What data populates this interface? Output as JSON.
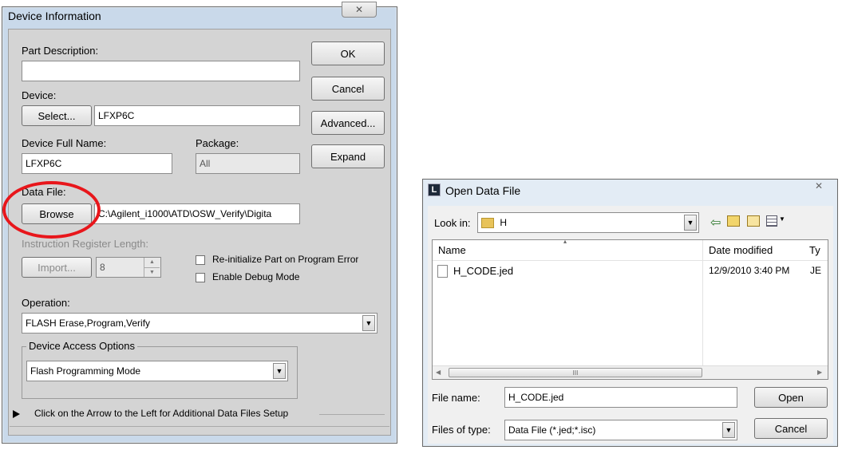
{
  "device_info": {
    "title": "Device Information",
    "close_icon": "✕",
    "part_description_label": "Part Description:",
    "part_description_value": "",
    "ok_label": "OK",
    "cancel_label": "Cancel",
    "advanced_label": "Advanced...",
    "expand_label": "Expand",
    "device_label": "Device:",
    "select_label": "Select...",
    "device_value": "LFXP6C",
    "device_full_name_label": "Device Full Name:",
    "device_full_name_value": "LFXP6C",
    "package_label": "Package:",
    "package_value": "All",
    "data_file_label": "Data File:",
    "browse_label": "Browse",
    "data_file_path": "C:\\Agilent_i1000\\ATD\\OSW_Verify\\Digita",
    "ir_length_label": "Instruction Register Length:",
    "import_label": "Import...",
    "ir_value": "8",
    "reinit_label": "Re-initialize Part on Program Error",
    "debug_label": "Enable Debug Mode",
    "operation_label": "Operation:",
    "operation_value": "FLASH Erase,Program,Verify",
    "access_group_label": "Device Access Options",
    "access_value": "Flash Programming Mode",
    "footer_text": "Click on the Arrow to the Left for Additional Data Files Setup",
    "highlight_color": "#e8161b"
  },
  "open_file": {
    "title": "Open Data File",
    "app_icon": "L",
    "look_in_label": "Look in:",
    "look_in_value": "H",
    "col_name": "Name",
    "col_date": "Date modified",
    "col_type": "Ty",
    "files": [
      {
        "name": "H_CODE.jed",
        "date": "12/9/2010 3:40 PM",
        "type": "JE"
      }
    ],
    "scroll_mid": "III",
    "file_name_label": "File name:",
    "file_name_value": "H_CODE.jed",
    "open_label": "Open",
    "files_of_type_label": "Files of type:",
    "files_of_type_value": "Data File (*.jed;*.isc)",
    "cancel_label": "Cancel"
  }
}
